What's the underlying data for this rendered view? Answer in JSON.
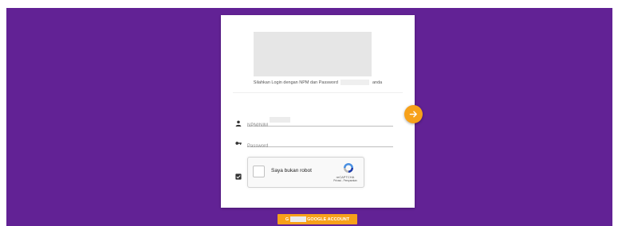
{
  "login": {
    "subtitle_before": "Silahkan Login dengan NPM dan Password",
    "subtitle_after": "anda",
    "npm_label": "NPM/NIM",
    "password_placeholder": "Password",
    "submit_icon": "arrow-right-icon"
  },
  "captcha": {
    "label": "Saya bukan robot",
    "brand": "reCAPTCHA",
    "links": "Privasi - Persyaratan"
  },
  "google_button": {
    "prefix": "G",
    "label": "GOOGLE ACCOUNT"
  },
  "colors": {
    "background": "#622295",
    "accent": "#f7a11a"
  }
}
